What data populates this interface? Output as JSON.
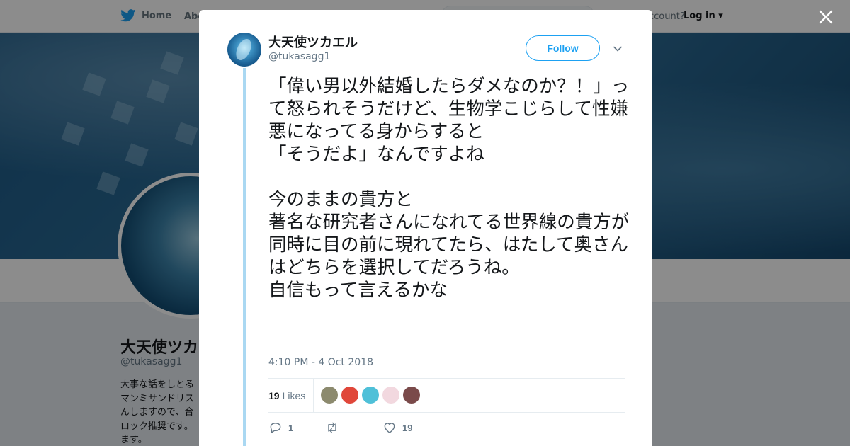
{
  "nav": {
    "home_label": "Home",
    "about_label": "Abo",
    "account_prompt": "ccount?",
    "login_label": "Log in"
  },
  "profile": {
    "name": "大天使ツカエ",
    "handle": "@tukasagg1",
    "bio": "大事な話をしとる\nマンミサンドリス\nんしますので、合\nロック推奨です。\nます。"
  },
  "tweet": {
    "author_name": "大天使ツカエル",
    "author_handle": "@tukasagg1",
    "follow_label": "Follow",
    "text": "「偉い男以外結婚したらダメなのか？！」って怒られそうだけど、生物学こじらして性嫌悪になってる身からすると\n「そうだよ」なんですよね\n\n今のままの貴方と\n著名な研究者さんになれてる世界線の貴方が同時に目の前に現れてたら、はたして奥さんはどちらを選択してだろうね。\n自信もって言えるかな",
    "timestamp": "4:10 PM - 4 Oct 2018",
    "likes_count": "19",
    "likes_label": "Likes",
    "reply_count": "1",
    "retweet_count": "",
    "like_count": "19"
  },
  "colors": {
    "accent": "#1da1f2",
    "thread_line": "#aad8f2",
    "muted_text": "#657786",
    "overlay": "rgba(0,0,0,0.45)"
  },
  "likers": [
    {
      "name": "liker-avatar-1",
      "color": "#8c8a6e"
    },
    {
      "name": "liker-avatar-2",
      "color": "#e0473a"
    },
    {
      "name": "liker-avatar-3",
      "color": "#4fc0d8"
    },
    {
      "name": "liker-avatar-4",
      "color": "#f2d8df"
    },
    {
      "name": "liker-avatar-5",
      "color": "#7a4a4a"
    }
  ],
  "icons": {
    "twitter": "twitter-bird-icon",
    "close": "close-icon",
    "caret": "chevron-down-icon",
    "reply": "reply-icon",
    "retweet": "retweet-icon",
    "like": "heart-icon"
  }
}
